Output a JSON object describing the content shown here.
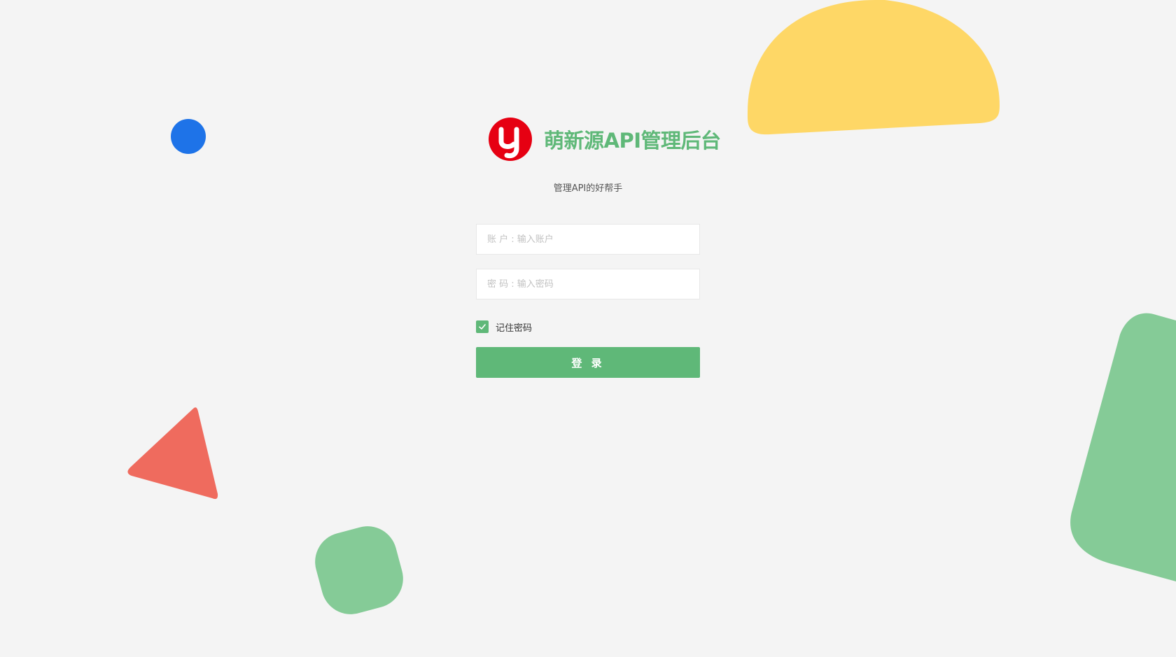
{
  "app": {
    "title": "萌新源API管理后台",
    "subtitle": "管理API的好帮手"
  },
  "form": {
    "account": {
      "placeholder": "账 户 : 输入账户",
      "value": ""
    },
    "password": {
      "placeholder": "密 码 : 输入密码",
      "value": ""
    },
    "remember": {
      "label": "记住密码",
      "checked": true
    },
    "login_label": "登 录"
  },
  "icons": {
    "logo": "y-logo-icon",
    "checkbox": "check-icon"
  },
  "colors": {
    "brand_green": "#5fb878",
    "logo_red": "#e60012",
    "shape_yellow": "#fed766",
    "shape_blue": "#1e73e8",
    "shape_red": "#ef6b5e",
    "shape_green": "#85cb97",
    "background": "#f4f4f4"
  }
}
